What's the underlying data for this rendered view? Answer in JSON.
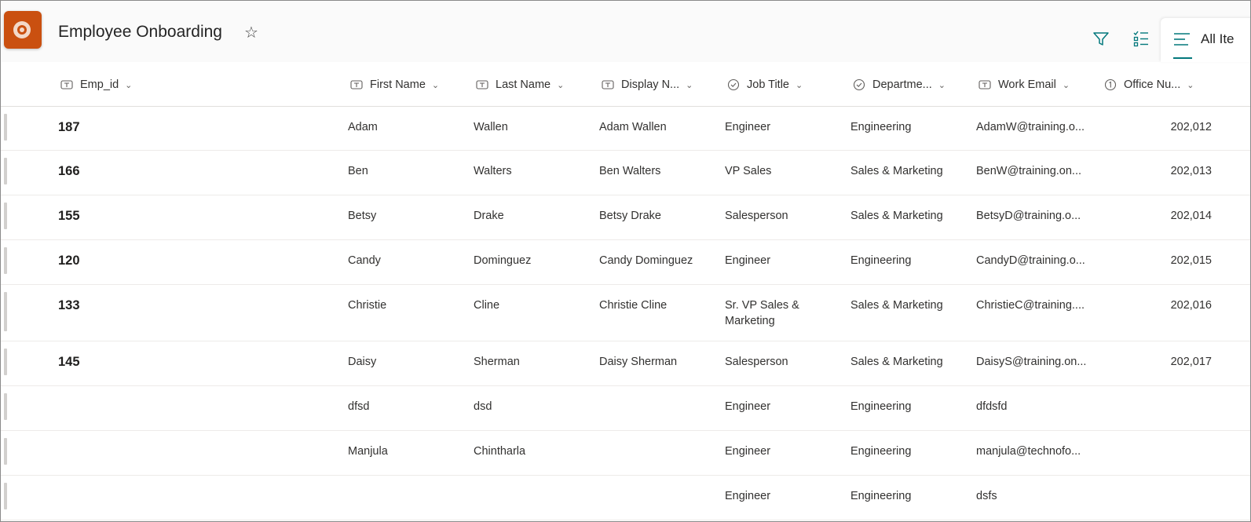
{
  "header": {
    "app_title": "Employee Onboarding",
    "favorite_icon": "star-outline-icon",
    "filter_icon": "filter-icon",
    "view_options_icon": "checklist-icon",
    "current_view": "All Ite",
    "brand_color": "#ca5010",
    "accent_color": "#03787c"
  },
  "columns": [
    {
      "label": "Emp_id",
      "type_icon": "text-field-icon"
    },
    {
      "label": "First Name",
      "type_icon": "text-field-icon"
    },
    {
      "label": "Last Name",
      "type_icon": "text-field-icon"
    },
    {
      "label": "Display N...",
      "type_icon": "text-field-icon"
    },
    {
      "label": "Job Title",
      "type_icon": "choice-field-icon"
    },
    {
      "label": "Departme...",
      "type_icon": "choice-field-icon"
    },
    {
      "label": "Work Email",
      "type_icon": "text-field-icon"
    },
    {
      "label": "Office Nu...",
      "type_icon": "number-field-icon"
    }
  ],
  "rows": [
    {
      "emp_id": "187",
      "first": "Adam",
      "last": "Wallen",
      "display": "Adam Wallen",
      "job": "Engineer",
      "dept": "Engineering",
      "email": "AdamW@training.o...",
      "office": "202,012"
    },
    {
      "emp_id": "166",
      "first": "Ben",
      "last": "Walters",
      "display": "Ben Walters",
      "job": "VP Sales",
      "dept": "Sales & Marketing",
      "email": "BenW@training.on...",
      "office": "202,013"
    },
    {
      "emp_id": "155",
      "first": "Betsy",
      "last": "Drake",
      "display": "Betsy Drake",
      "job": "Salesperson",
      "dept": "Sales & Marketing",
      "email": "BetsyD@training.o...",
      "office": "202,014"
    },
    {
      "emp_id": "120",
      "first": "Candy",
      "last": "Dominguez",
      "display": "Candy Dominguez",
      "job": "Engineer",
      "dept": "Engineering",
      "email": "CandyD@training.o...",
      "office": "202,015"
    },
    {
      "emp_id": "133",
      "first": "Christie",
      "last": "Cline",
      "display": "Christie Cline",
      "job": "Sr. VP Sales & Marketing",
      "dept": "Sales & Marketing",
      "email": "ChristieC@training....",
      "office": "202,016"
    },
    {
      "emp_id": "145",
      "first": "Daisy",
      "last": "Sherman",
      "display": "Daisy Sherman",
      "job": "Salesperson",
      "dept": "Sales & Marketing",
      "email": "DaisyS@training.on...",
      "office": "202,017"
    },
    {
      "emp_id": "",
      "first": "dfsd",
      "last": "dsd",
      "display": "",
      "job": "Engineer",
      "dept": "Engineering",
      "email": "dfdsfd",
      "office": ""
    },
    {
      "emp_id": "",
      "first": "Manjula",
      "last": "Chintharla",
      "display": "",
      "job": "Engineer",
      "dept": "Engineering",
      "email": "manjula@technofo...",
      "office": ""
    },
    {
      "emp_id": "",
      "first": "",
      "last": "",
      "display": "",
      "job": "Engineer",
      "dept": "Engineering",
      "email": "dsfs",
      "office": ""
    }
  ]
}
